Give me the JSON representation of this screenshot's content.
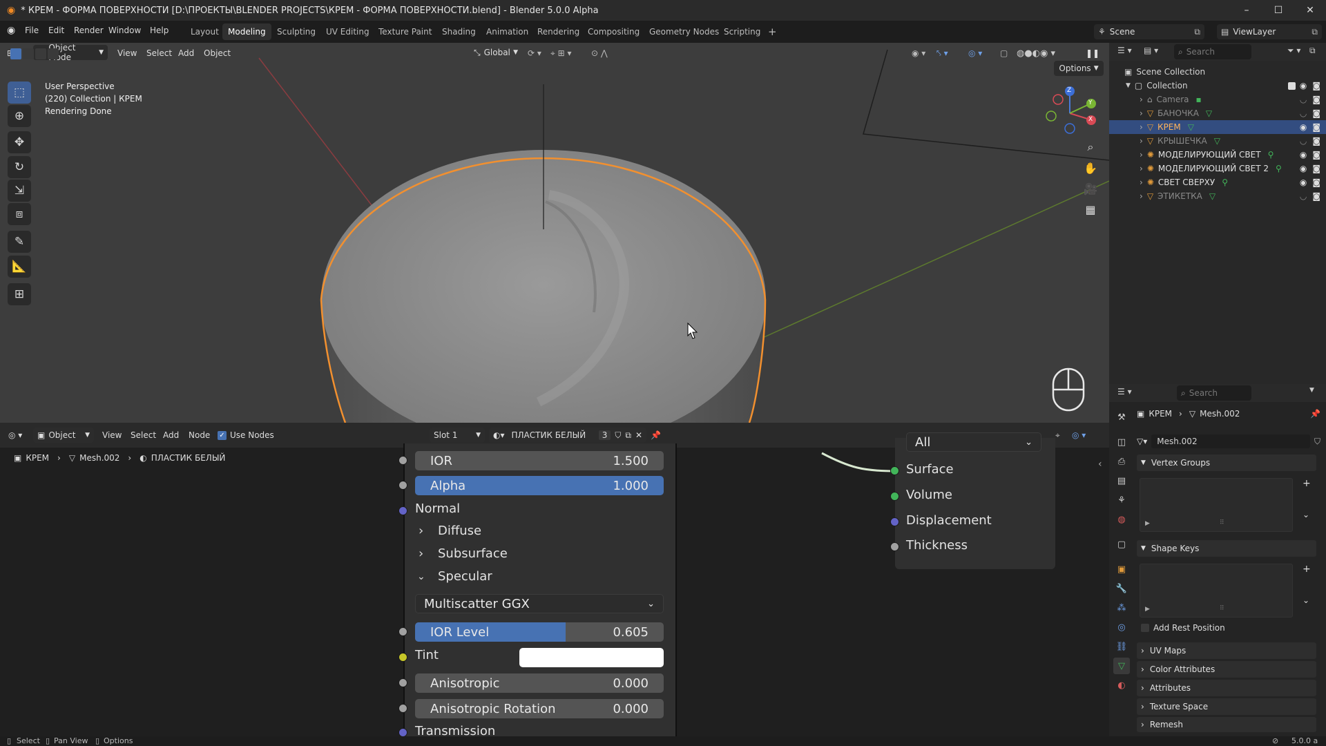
{
  "window": {
    "title": "* КРЕМ - ФОРМА ПОВЕРХНОСТИ [D:\\ПРОЕКТЫ\\BLENDER PROJECTS\\КРЕМ - ФОРМА ПОВЕРХНОСТИ.blend] - Blender 5.0.0 Alpha",
    "minimize": "–",
    "maximize": "☐",
    "close": "✕"
  },
  "menu": {
    "items": [
      "File",
      "Edit",
      "Render",
      "Window",
      "Help"
    ],
    "workspaces": [
      "Layout",
      "Modeling",
      "Sculpting",
      "UV Editing",
      "Texture Paint",
      "Shading",
      "Animation",
      "Rendering",
      "Compositing",
      "Geometry Nodes",
      "Scripting"
    ],
    "active_workspace": "Modeling",
    "add_workspace": "+",
    "scene": "Scene",
    "view_layer": "ViewLayer"
  },
  "viewport": {
    "mode": "Object Mode",
    "menus": [
      "View",
      "Select",
      "Add",
      "Object"
    ],
    "orientation": "Global",
    "options": "Options",
    "info": [
      "User Perspective",
      "(220) Collection | КРЕМ",
      "Rendering Done"
    ],
    "gizmo": {
      "x": "X",
      "y": "Y",
      "z": "Z"
    },
    "accent": "#f2902f"
  },
  "node_editor": {
    "editor_type": "Object",
    "menus": [
      "View",
      "Select",
      "Add",
      "Node"
    ],
    "use_nodes_label": "Use Nodes",
    "use_nodes": true,
    "slot": "Slot 1",
    "material": "ПЛАСТИК БЕЛЫЙ",
    "users": "3",
    "breadcrumb": [
      "КРЕМ",
      "Mesh.002",
      "ПЛАСТИК БЕЛЫЙ"
    ],
    "bsdf": {
      "ior_label": "IOR",
      "ior_value": "1.500",
      "alpha_label": "Alpha",
      "alpha_value": "1.000",
      "normal_label": "Normal",
      "diffuse_label": "Diffuse",
      "subsurface_label": "Subsurface",
      "specular_label": "Specular",
      "distribution": "Multiscatter GGX",
      "ior_level_label": "IOR Level",
      "ior_level_value": "0.605",
      "ior_level_fraction": 0.605,
      "tint_label": "Tint",
      "anisotropic_label": "Anisotropic",
      "anisotropic_value": "0.000",
      "aniso_rot_label": "Anisotropic Rotation",
      "aniso_rot_value": "0.000",
      "cut_label": "Transmission"
    },
    "output": {
      "target": "All",
      "sockets": [
        "Surface",
        "Volume",
        "Displacement",
        "Thickness"
      ]
    }
  },
  "outliner": {
    "search_placeholder": "Search",
    "scene_collection": "Scene Collection",
    "collection": "Collection",
    "items": [
      {
        "label": "Camera",
        "type": "camera",
        "selected": false,
        "visible": false
      },
      {
        "label": "БАНОЧКА",
        "type": "mesh",
        "selected": false,
        "visible": false
      },
      {
        "label": "КРЕМ",
        "type": "mesh",
        "selected": true,
        "visible": true
      },
      {
        "label": "КРЫШЕЧКА",
        "type": "mesh",
        "selected": false,
        "visible": false
      },
      {
        "label": "МОДЕЛИРУЮЩИЙ СВЕТ",
        "type": "light",
        "selected": false,
        "visible": true
      },
      {
        "label": "МОДЕЛИРУЮЩИЙ СВЕТ 2",
        "type": "light",
        "selected": false,
        "visible": true
      },
      {
        "label": "СВЕТ СВЕРХУ",
        "type": "light",
        "selected": false,
        "visible": true
      },
      {
        "label": "ЭТИКЕТКА",
        "type": "mesh",
        "selected": false,
        "visible": false
      }
    ]
  },
  "properties": {
    "search_placeholder": "Search",
    "object": "КРЕМ",
    "mesh": "Mesh.002",
    "mesh_field": "Mesh.002",
    "panels": {
      "vertex_groups": "Vertex Groups",
      "shape_keys": "Shape Keys",
      "add_rest_position": "Add Rest Position",
      "uv_maps": "UV Maps",
      "color_attributes": "Color Attributes",
      "attributes": "Attributes",
      "texture_space": "Texture Space",
      "remesh": "Remesh"
    }
  },
  "status": {
    "select": "Select",
    "pan_view": "Pan View",
    "options": "Options",
    "version": "5.0.0 a"
  }
}
